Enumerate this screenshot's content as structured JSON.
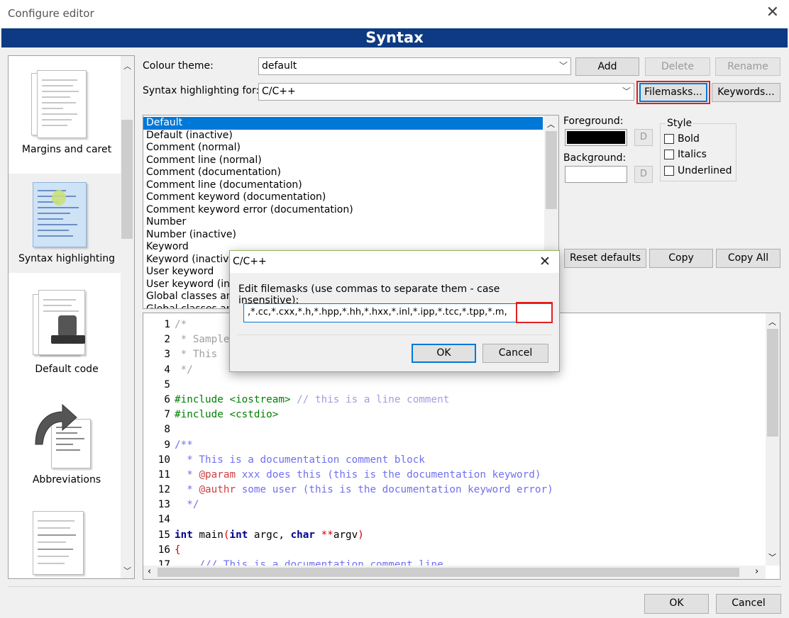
{
  "window": {
    "title": "Configure editor",
    "close_glyph": "✕"
  },
  "banner": {
    "title": "Syntax"
  },
  "sidebar": {
    "items": [
      {
        "label": "Margins and caret",
        "icon": "pages-icon"
      },
      {
        "label": "Syntax highlighting",
        "icon": "code-doc-icon",
        "selected": true
      },
      {
        "label": "Default code",
        "icon": "stamp-icon"
      },
      {
        "label": "Abbreviations",
        "icon": "arrow-doc-icon"
      },
      {
        "label": "",
        "icon": "list-doc-icon"
      }
    ]
  },
  "colour_theme": {
    "label": "Colour theme:",
    "value": "default"
  },
  "syntax_for": {
    "label": "Syntax highlighting for:",
    "value": "C/C++"
  },
  "buttons": {
    "add": "Add",
    "delete": "Delete",
    "rename": "Rename",
    "filemasks": "Filemasks...",
    "keywords": "Keywords...",
    "reset_defaults": "Reset defaults",
    "copy": "Copy",
    "copy_all": "Copy All",
    "ok": "OK",
    "cancel": "Cancel"
  },
  "style_list": [
    "Default",
    "Default (inactive)",
    "Comment (normal)",
    "Comment line (normal)",
    "Comment (documentation)",
    "Comment line (documentation)",
    "Comment keyword (documentation)",
    "Comment keyword error (documentation)",
    "Number",
    "Number (inactive)",
    "Keyword",
    "Keyword (inactive)",
    "User keyword",
    "User keyword (inactive)",
    "Global classes and typedefs",
    "Global classes and typedefs (inactive)"
  ],
  "colors": {
    "foreground_label": "Foreground:",
    "background_label": "Background:",
    "d_label": "D",
    "foreground_value": "#000000",
    "background_value": "#ffffff"
  },
  "style_box": {
    "title": "Style",
    "bold": "Bold",
    "italics": "Italics",
    "underlined": "Underlined"
  },
  "code_lines": [
    {
      "n": "1",
      "parts": [
        [
          "c-com",
          "/*"
        ]
      ]
    },
    {
      "n": "2",
      "parts": [
        [
          "c-com",
          " * Sample"
        ]
      ]
    },
    {
      "n": "3",
      "parts": [
        [
          "c-com",
          " * This "
        ]
      ]
    },
    {
      "n": "4",
      "parts": [
        [
          "c-com",
          " */"
        ]
      ]
    },
    {
      "n": "5",
      "parts": []
    },
    {
      "n": "6",
      "parts": [
        [
          "c-pp",
          "#include <iostream>"
        ],
        [
          "c-lc",
          " // this is a line comment"
        ]
      ]
    },
    {
      "n": "7",
      "parts": [
        [
          "c-pp",
          "#include <cstdio>"
        ]
      ]
    },
    {
      "n": "8",
      "parts": []
    },
    {
      "n": "9",
      "parts": [
        [
          "c-doc",
          "/**"
        ]
      ]
    },
    {
      "n": "10",
      "parts": [
        [
          "c-doc",
          "  * This is a documentation comment block"
        ]
      ]
    },
    {
      "n": "11",
      "parts": [
        [
          "c-doc",
          "  * "
        ],
        [
          "c-dockw",
          "@param"
        ],
        [
          "c-doc",
          " xxx does this (this is the documentation keyword)"
        ]
      ]
    },
    {
      "n": "12",
      "parts": [
        [
          "c-doc",
          "  * "
        ],
        [
          "c-dockw",
          "@authr"
        ],
        [
          "c-doc",
          " some user (this is the documentation keyword error)"
        ]
      ]
    },
    {
      "n": "13",
      "parts": [
        [
          "c-doc",
          "  */"
        ]
      ]
    },
    {
      "n": "14",
      "parts": []
    },
    {
      "n": "15",
      "parts": [
        [
          "c-kw",
          "int"
        ],
        [
          "",
          " main"
        ],
        [
          "c-op",
          "("
        ],
        [
          "c-kw",
          "int"
        ],
        [
          "",
          " argc, "
        ],
        [
          "c-kw",
          "char"
        ],
        [
          "c-op",
          " **"
        ],
        [
          "",
          "argv"
        ],
        [
          "c-op",
          ")"
        ]
      ]
    },
    {
      "n": "16",
      "parts": [
        [
          "c-op",
          "{"
        ]
      ]
    },
    {
      "n": "17",
      "parts": [
        [
          "c-doc",
          "    /// This is a documentation comment line"
        ]
      ]
    }
  ],
  "modal": {
    "title": "C/C++",
    "prompt": "Edit filemasks (use commas to separate them - case insensitive):",
    "value": ",*.cc,*.cxx,*.h,*.hpp,*.hh,*.hxx,*.inl,*.ipp,*.tcc,*.tpp,*.m,",
    "ok": "OK",
    "cancel": "Cancel"
  }
}
